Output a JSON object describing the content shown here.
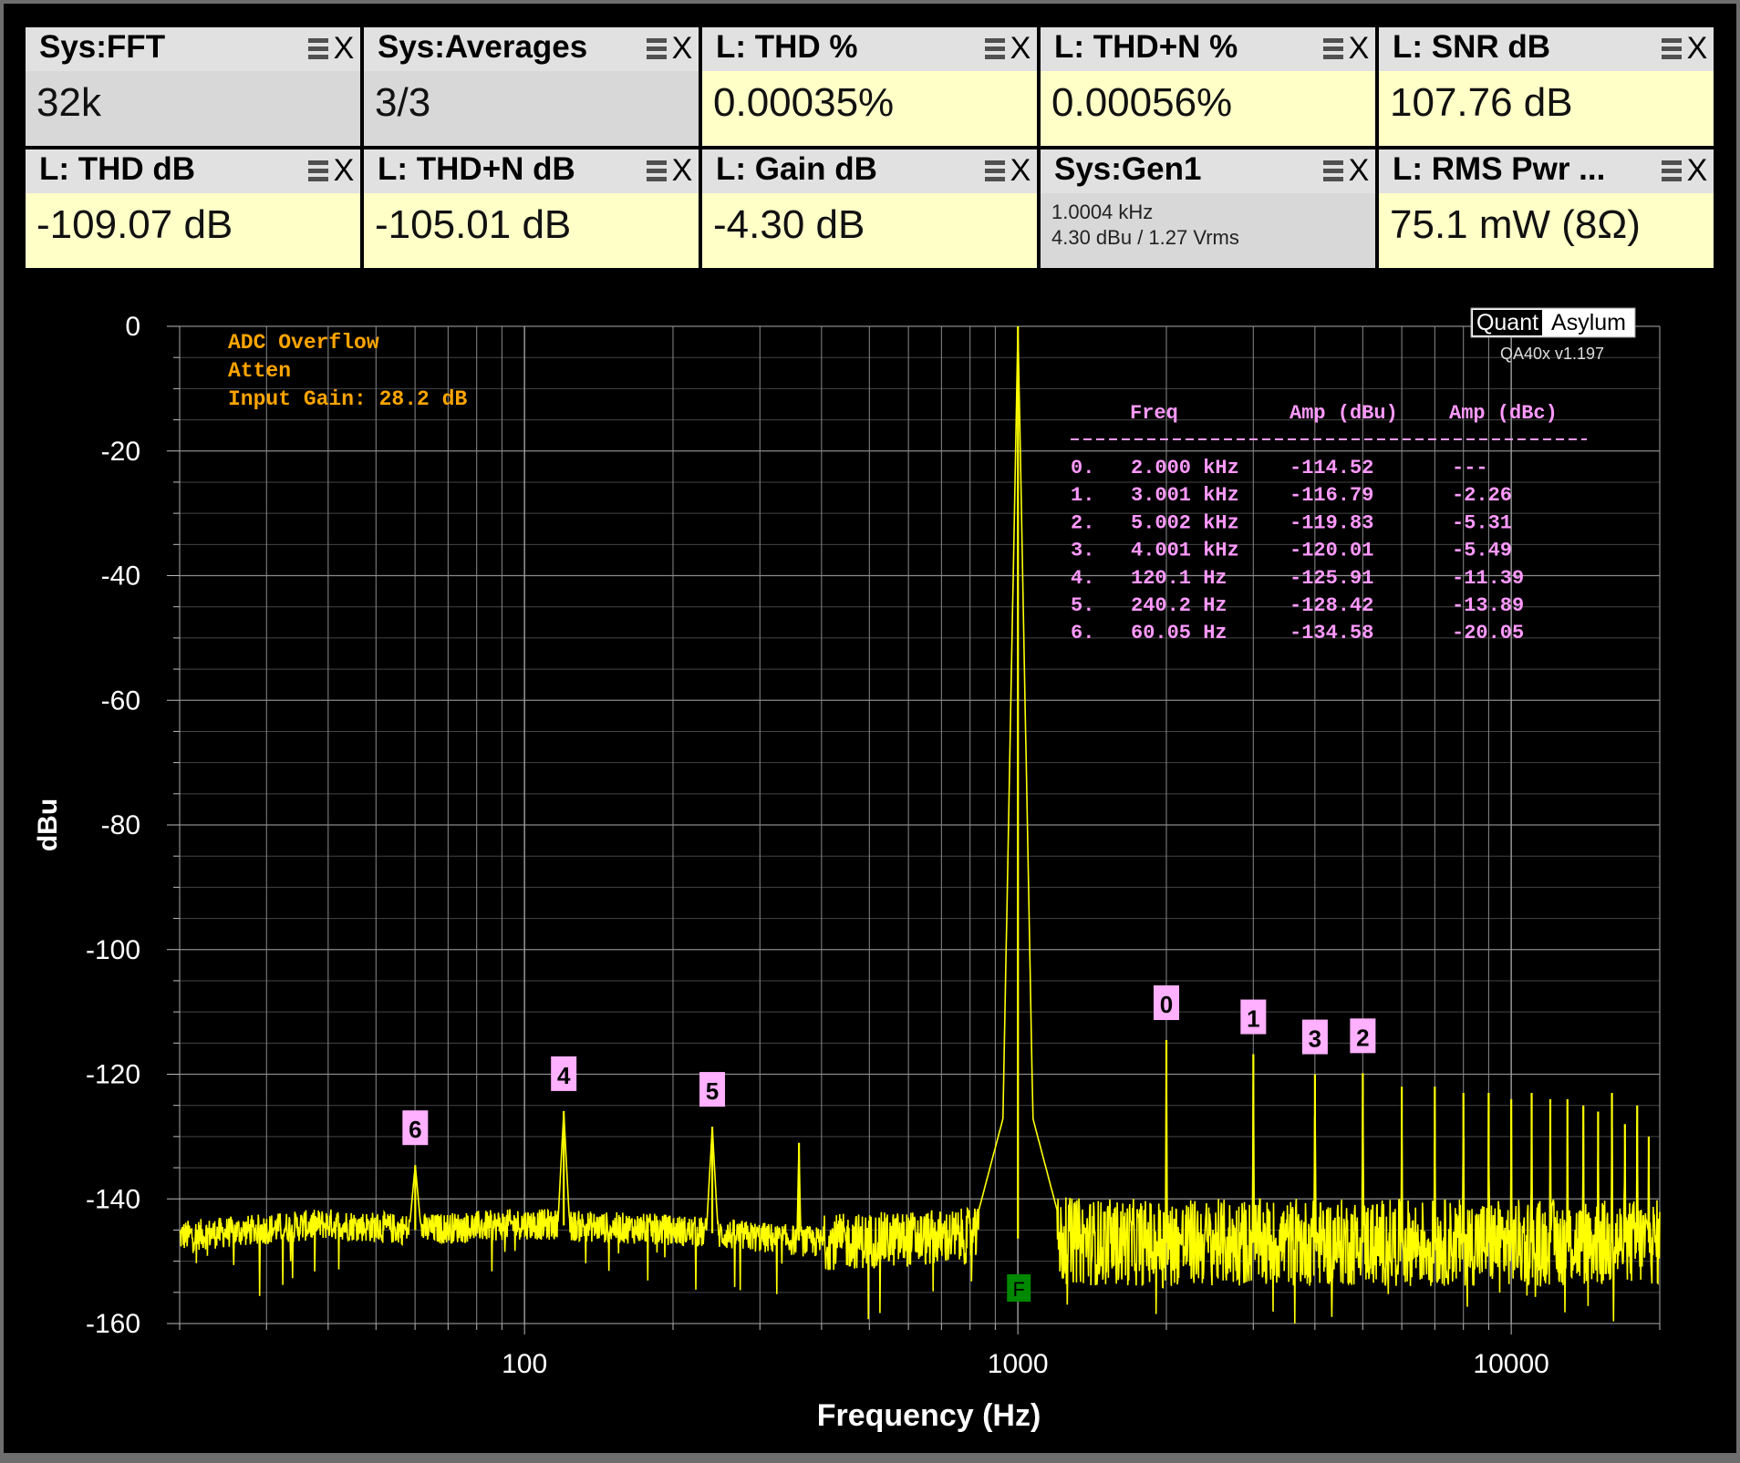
{
  "tiles": [
    {
      "title": "Sys:FFT",
      "value": "32k",
      "style": "grey"
    },
    {
      "title": "Sys:Averages",
      "value": "3/3",
      "style": "grey"
    },
    {
      "title": "L: THD %",
      "value": "0.00035%",
      "style": "yellow"
    },
    {
      "title": "L: THD+N %",
      "value": "0.00056%",
      "style": "yellow"
    },
    {
      "title": "L: SNR dB",
      "value": "107.76 dB",
      "style": "yellow"
    },
    {
      "title": "L: THD dB",
      "value": "-109.07 dB",
      "style": "yellow"
    },
    {
      "title": "L: THD+N dB",
      "value": "-105.01 dB",
      "style": "yellow"
    },
    {
      "title": "L: Gain dB",
      "value": "-4.30 dB",
      "style": "yellow"
    },
    {
      "title": "Sys:Gen1",
      "sub1": "1.0004 kHz",
      "sub2": "4.30 dBu  / 1.27 Vrms",
      "style": "grey"
    },
    {
      "title": "L: RMS Pwr ...",
      "value": "75.1 mW (8Ω)",
      "style": "yellow"
    }
  ],
  "icons": {
    "tile_menu": "hamburger-icon",
    "tile_close": "close-icon"
  },
  "colors": {
    "trace": "#ffff00",
    "label": "#ff99ff",
    "status": "#ffa500",
    "marker": "#ffb0ff",
    "fundamental_marker": "#008800",
    "grid": "#8a8a8a",
    "tile_value_bg": "#ffffc8",
    "tile_header_bg": "#e1e1e1"
  },
  "status_lines": [
    "ADC Overflow",
    "Atten",
    "Input Gain: 28.2 dB"
  ],
  "brand": {
    "left": "Quant",
    "right": "Asylum",
    "version": "QA40x v1.197"
  },
  "harmonic_table": {
    "headers": [
      "Freq",
      "Amp (dBu)",
      "Amp (dBc)"
    ],
    "separator": "------------------------------------",
    "rows": [
      {
        "idx": "0.",
        "freq": "2.000 kHz",
        "amp_dbu": "-114.52",
        "amp_dbc": "---"
      },
      {
        "idx": "1.",
        "freq": "3.001 kHz",
        "amp_dbu": "-116.79",
        "amp_dbc": "-2.26"
      },
      {
        "idx": "2.",
        "freq": "5.002 kHz",
        "amp_dbu": "-119.83",
        "amp_dbc": "-5.31"
      },
      {
        "idx": "3.",
        "freq": "4.001 kHz",
        "amp_dbu": "-120.01",
        "amp_dbc": "-5.49"
      },
      {
        "idx": "4.",
        "freq": "120.1 Hz",
        "amp_dbu": "-125.91",
        "amp_dbc": "-11.39"
      },
      {
        "idx": "5.",
        "freq": "240.2 Hz",
        "amp_dbu": "-128.42",
        "amp_dbc": "-13.89"
      },
      {
        "idx": "6.",
        "freq": "60.05 Hz",
        "amp_dbu": "-134.58",
        "amp_dbc": "-20.05"
      }
    ]
  },
  "fundamental_label": "F",
  "chart_data": {
    "type": "line",
    "xlabel": "Frequency (Hz)",
    "ylabel": "dBu",
    "x_scale": "log",
    "xlim": [
      20,
      20000
    ],
    "ylim": [
      -160,
      0
    ],
    "xticks": [
      100,
      1000,
      10000
    ],
    "yticks": [
      0,
      -20,
      -40,
      -60,
      -80,
      -100,
      -120,
      -140,
      -160
    ],
    "grid": true,
    "fundamental": {
      "freq": 1000.4,
      "amp": 0
    },
    "harmonic_markers": [
      {
        "label": "0",
        "freq": 2000,
        "amp": -114.52
      },
      {
        "label": "1",
        "freq": 3001,
        "amp": -116.79
      },
      {
        "label": "2",
        "freq": 5002,
        "amp": -119.83
      },
      {
        "label": "3",
        "freq": 4001,
        "amp": -120.01
      },
      {
        "label": "4",
        "freq": 120.1,
        "amp": -125.91
      },
      {
        "label": "5",
        "freq": 240.2,
        "amp": -128.42
      },
      {
        "label": "6",
        "freq": 60.05,
        "amp": -134.58
      }
    ],
    "spurs": [
      {
        "freq": 360,
        "amp": -131
      },
      {
        "freq": 6000,
        "amp": -122
      },
      {
        "freq": 7000,
        "amp": -122
      },
      {
        "freq": 8000,
        "amp": -123
      },
      {
        "freq": 9000,
        "amp": -123
      },
      {
        "freq": 10000,
        "amp": -124
      },
      {
        "freq": 11000,
        "amp": -123
      },
      {
        "freq": 12000,
        "amp": -124
      },
      {
        "freq": 13000,
        "amp": -124
      },
      {
        "freq": 14000,
        "amp": -125
      },
      {
        "freq": 15000,
        "amp": -126
      },
      {
        "freq": 16000,
        "amp": -123
      },
      {
        "freq": 17000,
        "amp": -128
      },
      {
        "freq": 18000,
        "amp": -125
      },
      {
        "freq": 19000,
        "amp": -130
      }
    ],
    "noise_floor": [
      {
        "freq": 20,
        "amp": -146
      },
      {
        "freq": 40,
        "amp": -144
      },
      {
        "freq": 60,
        "amp": -145
      },
      {
        "freq": 100,
        "amp": -144
      },
      {
        "freq": 200,
        "amp": -145
      },
      {
        "freq": 400,
        "amp": -147
      },
      {
        "freq": 800,
        "amp": -146
      },
      {
        "freq": 1500,
        "amp": -147
      },
      {
        "freq": 4000,
        "amp": -147
      },
      {
        "freq": 10000,
        "amp": -147
      },
      {
        "freq": 20000,
        "amp": -147
      }
    ]
  }
}
